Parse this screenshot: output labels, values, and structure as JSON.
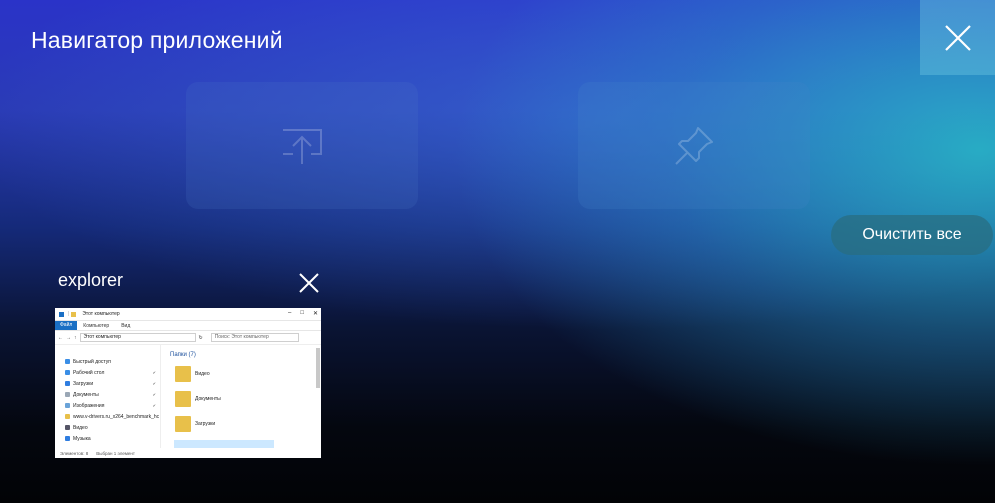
{
  "header": {
    "title": "Навигатор приложений"
  },
  "actions": {
    "clear_all_label": "Очистить все"
  },
  "app_card": {
    "name": "explorer",
    "thumbnail": {
      "window_title": "Этот компьютер",
      "ribbon_tabs": [
        "Файл",
        "Компьютер",
        "Вид"
      ],
      "address": "Этот компьютер",
      "search_placeholder": "Поиск: Этот компьютер",
      "nav_items": [
        "Быстрый доступ",
        "Рабочий стол",
        "Загрузки",
        "Документы",
        "Изображения",
        "www.v-drivers.ru_x264_benchmark_hc",
        "Видео",
        "Музыка"
      ],
      "group_label": "Папки (7)",
      "folders": [
        "Видео",
        "Документы",
        "Загрузки"
      ],
      "status_items": "Элементов: 8",
      "status_selected": "Выбран 1 элемент"
    }
  },
  "colors": {
    "accent": "#1a6fc4",
    "clear_button_bg": "#286e82"
  }
}
